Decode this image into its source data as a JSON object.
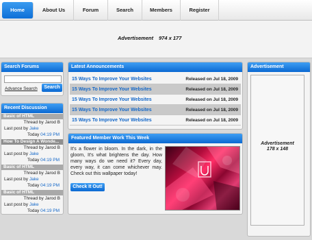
{
  "nav": {
    "items": [
      {
        "label": "Home"
      },
      {
        "label": "About Us"
      },
      {
        "label": "Forum"
      },
      {
        "label": "Search"
      },
      {
        "label": "Members"
      },
      {
        "label": "Register"
      }
    ]
  },
  "banner": {
    "label": "Advertisement",
    "size": "974 x 177"
  },
  "search": {
    "title": "Search Forums",
    "advanced": "Advance Search",
    "button": "Search",
    "input_value": ""
  },
  "discussion": {
    "title": "Recent Discussion",
    "items": [
      {
        "title": "Basic of HTML",
        "thread_by": "Thread by",
        "author": "Jarod B",
        "last_post": "Last post by",
        "last_user": "Jake",
        "day": "Today",
        "time": "04:19 PM"
      },
      {
        "title": "How To Design A Wonde...",
        "thread_by": "Thread by",
        "author": "Jarod B",
        "last_post": "Last post by",
        "last_user": "Jake",
        "day": "Today",
        "time": "04:19 PM"
      },
      {
        "title": "Basic of HTML",
        "thread_by": "Thread by",
        "author": "Jarod B",
        "last_post": "Last post by",
        "last_user": "Jake",
        "day": "Today",
        "time": "04:19 PM"
      },
      {
        "title": "Basic of HTML",
        "thread_by": "Thread by",
        "author": "Jarod B",
        "last_post": "Last post by",
        "last_user": "Jake",
        "day": "Today",
        "time": "04:19 PM"
      }
    ]
  },
  "announcements": {
    "title": "Latest Announcements",
    "items": [
      {
        "title": "15 Ways To Improve Your Websites",
        "date": "Released on  Jul 18, 2009"
      },
      {
        "title": "15 Ways To Improve Your Websites",
        "date": "Released on  Jul 18, 2009"
      },
      {
        "title": "15 Ways To Improve Your Websites",
        "date": "Released on  Jul 18, 2009"
      },
      {
        "title": "15 Ways To Improve Your Websites",
        "date": "Released on  Jul 18, 2009"
      },
      {
        "title": "15 Ways To Improve Your Websites",
        "date": "Released on  Jul 18, 2009"
      }
    ]
  },
  "featured": {
    "title": "Featured Member Work This Week",
    "text": "It's a flower in bloom. In the dark, in the gloom, It's what brightens the day. How many ways do we need it? Every day, every way, it can come whichever may. Check out this wallpaper today!",
    "button": "Check It Out!"
  },
  "side_ad": {
    "title": "Advertisement",
    "label": "Advertisement",
    "size": "178 x 148"
  },
  "colors": {
    "accent": "#0b69d2",
    "link": "#1367c8"
  }
}
